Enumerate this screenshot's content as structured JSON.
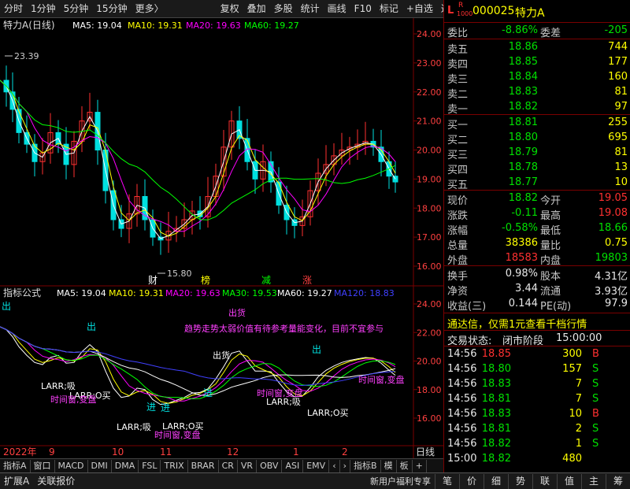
{
  "toolbar": {
    "left": [
      "分时",
      "1分钟",
      "5分钟",
      "15分钟",
      "更多〉"
    ],
    "right": [
      "复权",
      "叠加",
      "多股",
      "统计",
      "画线",
      "F10",
      "标记",
      "+自选",
      "返回"
    ]
  },
  "main_chart": {
    "title": "特力A(日线)",
    "legend": [
      {
        "text": "MA5: 19.04",
        "color": "#ffffff"
      },
      {
        "text": "MA10: 19.31",
        "color": "#ffff00"
      },
      {
        "text": "MA20: 19.63",
        "color": "#ff00ff"
      },
      {
        "text": "MA60: 19.27",
        "color": "#00ff00"
      }
    ],
    "yticks": [
      "24.00",
      "23.00",
      "22.00",
      "21.00",
      "20.00",
      "19.00",
      "18.00",
      "17.00",
      "16.00"
    ],
    "high_label": "23.39",
    "low_label": "15.80",
    "markers": [
      {
        "text": "财",
        "color": "#ffffff"
      },
      {
        "text": "榜",
        "color": "#ffff00"
      },
      {
        "text": "减",
        "color": "#00ff00"
      },
      {
        "text": "涨",
        "color": "#ff4040"
      }
    ]
  },
  "indicator": {
    "title": "指标公式",
    "legend": [
      {
        "text": "MA5: 19.04",
        "color": "#ffffff"
      },
      {
        "text": "MA10: 19.31",
        "color": "#ffff00"
      },
      {
        "text": "MA20: 19.63",
        "color": "#ff00ff"
      },
      {
        "text": "MA30: 19.53",
        "color": "#00ff00"
      },
      {
        "text": "MA60: 19.27",
        "color": "#ffffff"
      },
      {
        "text": "MA120: 18.83",
        "color": "#4040ff"
      }
    ],
    "yticks": [
      "24.00",
      "22.00",
      "20.00",
      "18.00",
      "16.00"
    ],
    "notice": "趋势走势太弱价值有待参考量能变化，目前不宜参与",
    "labels": {
      "out": "出",
      "out_goods": "出货",
      "larr_buy": "LARR;吸",
      "larr_o_buy": "LARR;O买",
      "window": "时间窗,变盘",
      "in": "进"
    }
  },
  "xaxis": {
    "labels": [
      "2022年",
      "9",
      "10",
      "11",
      "12",
      "1",
      "2"
    ],
    "end_label": "日线"
  },
  "panel": {
    "code": "000025",
    "name": "特力A",
    "badge_l": "L",
    "badge_r": "R",
    "badge_num": "1000",
    "weibi_label": "委比",
    "weibi_value": "-8.86%",
    "weicha_label": "委差",
    "weicha_value": "-205",
    "sells": [
      {
        "label": "卖五",
        "price": "18.86",
        "vol": "744"
      },
      {
        "label": "卖四",
        "price": "18.85",
        "vol": "177"
      },
      {
        "label": "卖三",
        "price": "18.84",
        "vol": "160"
      },
      {
        "label": "卖二",
        "price": "18.83",
        "vol": "81"
      },
      {
        "label": "卖一",
        "price": "18.82",
        "vol": "97"
      }
    ],
    "buys": [
      {
        "label": "买一",
        "price": "18.81",
        "vol": "255"
      },
      {
        "label": "买二",
        "price": "18.80",
        "vol": "695"
      },
      {
        "label": "买三",
        "price": "18.79",
        "vol": "81"
      },
      {
        "label": "买四",
        "price": "18.78",
        "vol": "13"
      },
      {
        "label": "买五",
        "price": "18.77",
        "vol": "10"
      }
    ],
    "quote": [
      {
        "l": "现价",
        "lv": "18.82",
        "lc": "green",
        "r": "今开",
        "rv": "19.05",
        "rc": "red"
      },
      {
        "l": "涨跌",
        "lv": "-0.11",
        "lc": "green",
        "r": "最高",
        "rv": "19.08",
        "rc": "red"
      },
      {
        "l": "涨幅",
        "lv": "-0.58%",
        "lc": "green",
        "r": "最低",
        "rv": "18.66",
        "rc": "green"
      },
      {
        "l": "总量",
        "lv": "38386",
        "lc": "yellow",
        "r": "量比",
        "rv": "0.75",
        "rc": "yellow"
      },
      {
        "l": "外盘",
        "lv": "18583",
        "lc": "red",
        "r": "内盘",
        "rv": "19803",
        "rc": "green"
      }
    ],
    "stats": [
      {
        "l": "换手",
        "lv": "0.98%",
        "r": "股本",
        "rv": "4.31亿"
      },
      {
        "l": "净资",
        "lv": "3.44",
        "r": "流通",
        "rv": "3.93亿"
      },
      {
        "l": "收益(三)",
        "lv": "0.144",
        "r": "PE(动)",
        "rv": "97.9"
      }
    ],
    "ad_text": "通达信，仅需1元查看千档行情",
    "status_label": "交易状态:",
    "status_value": "闭市阶段",
    "status_time": "15:00:00",
    "ticks": [
      {
        "t": "14:56",
        "p": "18.85",
        "pc": "red",
        "v": "300",
        "d": "B"
      },
      {
        "t": "14:56",
        "p": "18.80",
        "pc": "green",
        "v": "157",
        "d": "S"
      },
      {
        "t": "14:56",
        "p": "18.83",
        "pc": "green",
        "v": "7",
        "d": "S"
      },
      {
        "t": "14:56",
        "p": "18.81",
        "pc": "green",
        "v": "7",
        "d": "S"
      },
      {
        "t": "14:56",
        "p": "18.83",
        "pc": "green",
        "v": "10",
        "d": "B"
      },
      {
        "t": "14:56",
        "p": "18.81",
        "pc": "green",
        "v": "2",
        "d": "S"
      },
      {
        "t": "14:56",
        "p": "18.82",
        "pc": "green",
        "v": "1",
        "d": "S"
      },
      {
        "t": "15:00",
        "p": "18.82",
        "pc": "green",
        "v": "480",
        "d": ""
      }
    ]
  },
  "tabs_row1": [
    "指标A",
    "窗口",
    "MACD",
    "DMI",
    "DMA",
    "FSL",
    "TRIX",
    "BRAR",
    "CR",
    "VR",
    "OBV",
    "ASI",
    "EMV",
    "‹",
    "›",
    "指标B",
    "模",
    "板",
    "+"
  ],
  "tabs_row2_left": [
    "扩展A",
    "关联报价"
  ],
  "tabs_row2_promo": "新用户福利专享",
  "side_tabs": [
    "笔",
    "价",
    "细",
    "势",
    "联",
    "值",
    "主",
    "筹"
  ]
}
